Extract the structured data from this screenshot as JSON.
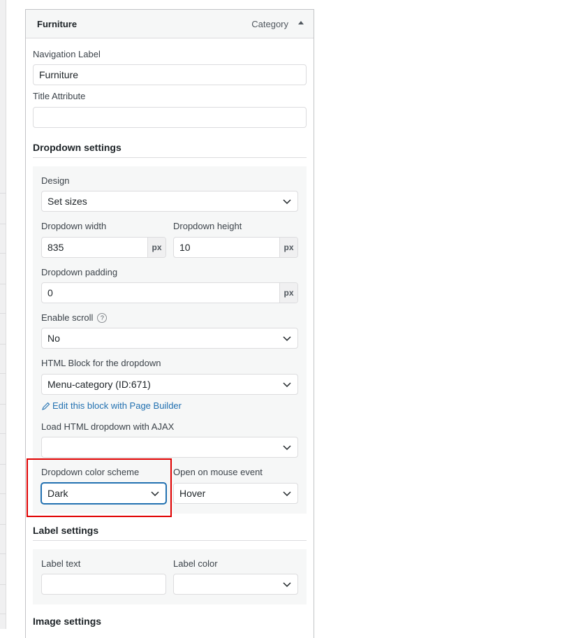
{
  "item": {
    "title": "Furniture",
    "type": "Category"
  },
  "nav_label": {
    "label": "Navigation Label",
    "value": "Furniture"
  },
  "title_attr": {
    "label": "Title Attribute",
    "value": ""
  },
  "dropdown": {
    "section": "Dropdown settings",
    "design": {
      "label": "Design",
      "value": "Set sizes"
    },
    "width": {
      "label": "Dropdown width",
      "value": "835",
      "unit": "px"
    },
    "height": {
      "label": "Dropdown height",
      "value": "10",
      "unit": "px"
    },
    "padding": {
      "label": "Dropdown padding",
      "value": "0",
      "unit": "px"
    },
    "scroll": {
      "label": "Enable scroll",
      "help": "?",
      "value": "No"
    },
    "html_block": {
      "label": "HTML Block for the dropdown",
      "value": "Menu-category (ID:671)"
    },
    "edit_link": "Edit this block with Page Builder",
    "ajax": {
      "label": "Load HTML dropdown with AJAX",
      "value": ""
    },
    "color_scheme": {
      "label": "Dropdown color scheme",
      "value": "Dark"
    },
    "mouse_event": {
      "label": "Open on mouse event",
      "value": "Hover"
    }
  },
  "label_settings": {
    "section": "Label settings",
    "text": {
      "label": "Label text",
      "value": ""
    },
    "color": {
      "label": "Label color",
      "value": ""
    }
  },
  "image_settings": {
    "section": "Image settings"
  },
  "colors": {
    "highlight": "#e00000",
    "link": "#2271b1"
  }
}
